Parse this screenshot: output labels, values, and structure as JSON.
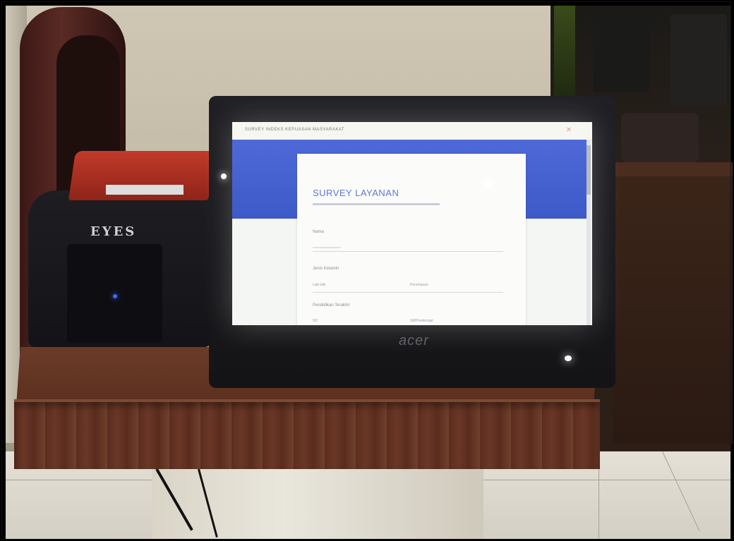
{
  "scene": {
    "printer_logo": "EYES",
    "monitor_brand": "acer"
  },
  "screen": {
    "window_title": "SURVEY INDEKS KEPUASAN MASYARAKAT",
    "close_glyph": "✕",
    "form_title": "SURVEY LAYANAN",
    "fields": [
      {
        "label": "Nama"
      },
      {
        "label": "Jenis Kelamin",
        "options": [
          "Laki-laki",
          "Perempuan"
        ]
      },
      {
        "label": "Pendidikan Terakhir",
        "options": [
          "SD",
          "SMP/sederajat"
        ]
      }
    ]
  },
  "colors": {
    "banner": "#4f69d8",
    "title_accent": "#5b78d8",
    "printer_lid": "#c23a2a",
    "printer_led": "#3d6cff",
    "table_wood": "#6b3b27"
  }
}
